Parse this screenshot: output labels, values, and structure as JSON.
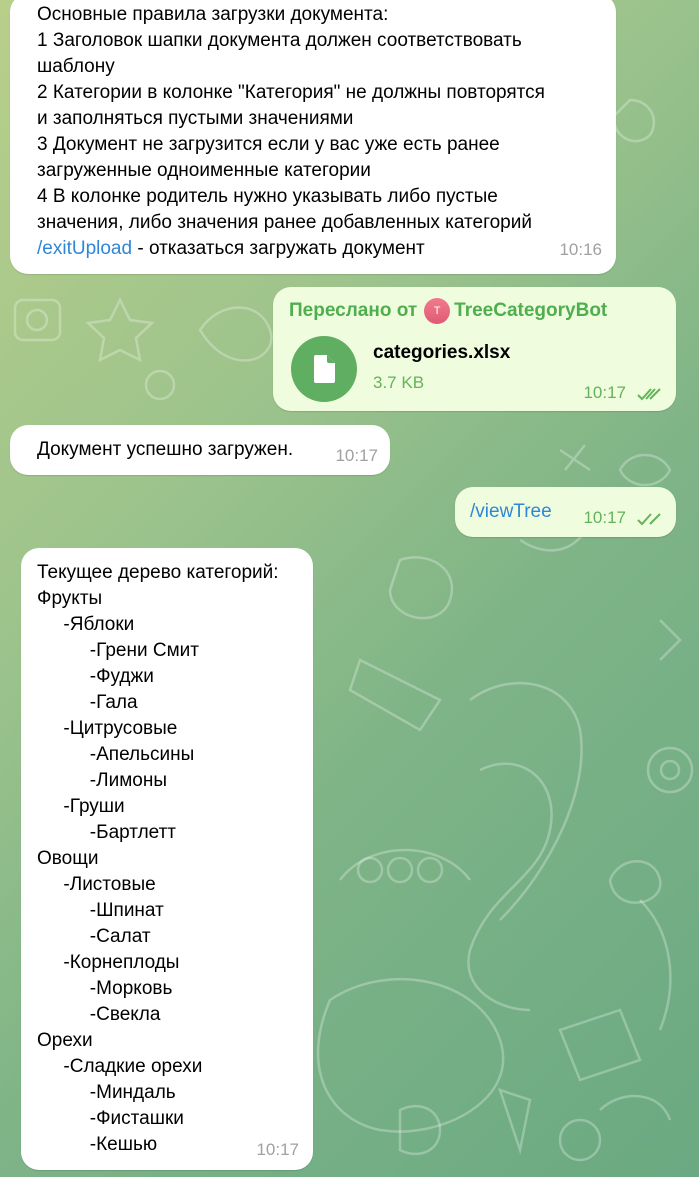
{
  "colors": {
    "incoming_bubble": "#ffffff",
    "outgoing_bubble": "#effdde",
    "link": "#2f86d6",
    "time_outgoing": "#64b35a",
    "forward_label": "#4fae4e"
  },
  "messages": {
    "rules": {
      "lines": [
        "Основные правила загрузки документа:",
        "1 Заголовок шапки документа должен соответствовать",
        "шаблону",
        "2 Категории в колонке \"Категория\" не должны повторятся",
        "и заполняться пустыми значениями",
        "3 Документ не загрузится если у вас уже есть ранее",
        "загруженные одноименные категории",
        "4 В колонке родитель нужно указывать либо пустые",
        "значения, либо значения ранее добавленных категорий"
      ],
      "exit_command": "/exitUpload",
      "exit_text": " - отказаться загружать документ",
      "time": "10:16"
    },
    "forwarded": {
      "forward_label": "Переслано от",
      "avatar_letter": "T",
      "sender": "TreeCategoryBot",
      "file_name": "categories.xlsx",
      "file_size": "3.7 KB",
      "time": "10:17"
    },
    "upload_success": {
      "text": "Документ успешно загружен.",
      "time": "10:17"
    },
    "view_tree": {
      "command": "/viewTree",
      "time": "10:17"
    },
    "tree": {
      "lines": [
        "Текущее дерево категорий:",
        "Фрукты",
        "     -Яблоки",
        "          -Грени Смит",
        "          -Фуджи",
        "          -Гала",
        "     -Цитрусовые",
        "          -Апельсины",
        "          -Лимоны",
        "     -Груши",
        "          -Бартлетт",
        "Овощи",
        "     -Листовые",
        "          -Шпинат",
        "          -Салат",
        "     -Корнеплоды",
        "          -Морковь",
        "          -Свекла",
        "Орехи",
        "     -Сладкие орехи",
        "          -Миндаль",
        "          -Фисташки",
        "          -Кешью"
      ],
      "time": "10:17"
    }
  }
}
